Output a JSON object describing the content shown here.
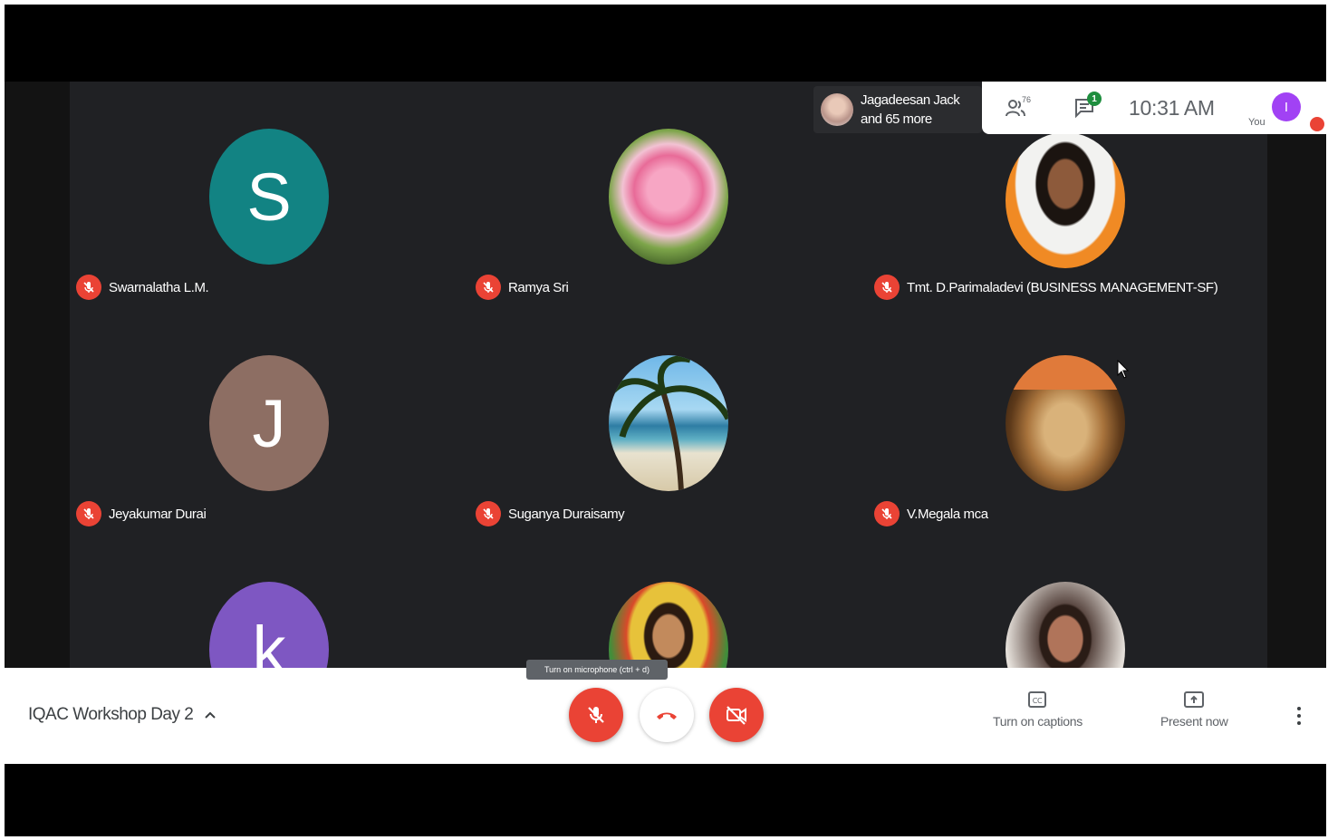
{
  "meeting": {
    "title": "IQAC Workshop Day 2",
    "time": "10:31 AM",
    "participants_badge": "76",
    "chat_badge": "1",
    "you_label": "You",
    "you_initial": "I",
    "presenter_chip": {
      "line1": "Jagadeesan Jack",
      "line2": "and 65 more"
    }
  },
  "participants": [
    {
      "name": "Swarnalatha L.M.",
      "avatar_type": "letter",
      "letter": "S",
      "color": "#128383",
      "muted": true
    },
    {
      "name": "Ramya Sri",
      "avatar_type": "photo",
      "photo": "lotus",
      "muted": true
    },
    {
      "name": "Tmt. D.Parimaladevi (BUSINESS MANAGEMENT-SF)",
      "avatar_type": "photo",
      "photo": "woman-portrait",
      "muted": true
    },
    {
      "name": "Jeyakumar Durai",
      "avatar_type": "letter",
      "letter": "J",
      "color": "#8d6e63",
      "muted": true
    },
    {
      "name": "Suganya Duraisamy",
      "avatar_type": "photo",
      "photo": "beach-palm",
      "muted": true
    },
    {
      "name": "V.Megala mca",
      "avatar_type": "photo",
      "photo": "saint-portrait",
      "muted": true
    },
    {
      "name": "",
      "avatar_type": "letter",
      "letter": "k",
      "color": "#7e57c2",
      "muted": true
    },
    {
      "name": "",
      "avatar_type": "photo",
      "photo": "woman-flowers",
      "muted": true
    },
    {
      "name": "",
      "avatar_type": "photo",
      "photo": "woman-photo",
      "muted": true
    }
  ],
  "controls": {
    "mic_tooltip": "Turn on microphone (ctrl + d)",
    "mic_icon": "mic-off-icon",
    "hangup_icon": "phone-hangup-icon",
    "camera_icon": "camera-off-icon"
  },
  "actions": {
    "captions_label": "Turn on captions",
    "present_label": "Present now"
  },
  "colors": {
    "grid_background": "#202124",
    "accent_red": "#ea4335",
    "you_avatar": "#a142f4"
  }
}
